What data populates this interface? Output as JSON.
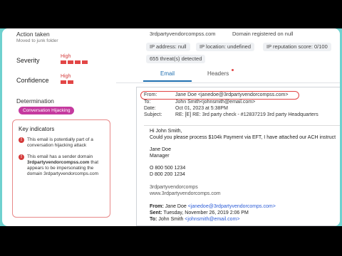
{
  "left": {
    "action_title": "Action taken",
    "action_sub": "Moved to junk folder",
    "severity_label": "Severity",
    "severity_value": "High",
    "confidence_label": "Confidence",
    "confidence_value": "High",
    "determination_label": "Determination",
    "determination_chip": "Conversation Hijacking",
    "key_indicators": {
      "title": "Key indicators",
      "item1": "This email is potentially part of a conversation hijacking attack",
      "item2_pre": "This email has a sender domain ",
      "item2_domain": "3rdpartyvendorcompss.com",
      "item2_mid": " that appears to be impersonating the domain ",
      "item2_domain2": "3rdpartyvendorcomps.com"
    }
  },
  "right": {
    "tags": {
      "t1": "3rdpartyvendorcompss.com",
      "t2": "Domain registered on null",
      "t3": "IP address: null",
      "t4": "IP location: undefined",
      "t5": "IP reputation score: 0/100",
      "t6": "655 threat(s) detected"
    },
    "tabs": {
      "email": "Email",
      "headers": "Headers"
    },
    "email": {
      "from_key": "From:",
      "from_val": "Jane Doe <janedoe@3rdpartyvendorcompss.com>",
      "to_key": "To:",
      "to_val": "John Smith<johnsmith@email.com>",
      "date_key": "Date:",
      "date_val": "Oct 01, 2023 at 5:38PM",
      "subject_key": "Subject:",
      "subject_val": "RE: [E] RE: 3rd party check - #12837219 3rd party Headquarters",
      "greeting": "Hi John Smith,",
      "line1": "Could you please process $104k Payment via EFT, I have attached our ACH instruct",
      "sig_name": "Jane Doe",
      "sig_title": "Manager",
      "phone_o": "O 800 500 1234",
      "phone_d": "D 800 200 1234",
      "company": "3rdpartyvendorcomps",
      "website": "www.3rdpartyvendorcomps.com",
      "q_from_key": "From:",
      "q_from_name": "Jane Doe ",
      "q_from_email": "<janedoe@3rdpartyvendorcomps.com>",
      "q_sent_key": "Sent:",
      "q_sent_val": " Tuesday, November 26, 2019 2:06 PM",
      "q_to_key": "To:",
      "q_to_name": " John Smith ",
      "q_to_email": "<johnsmith@email.com>"
    }
  },
  "colors": {
    "accent": "#1f6fb0",
    "danger": "#e24646",
    "chip": "#c53a9f",
    "frame": "#6fd1cf"
  }
}
